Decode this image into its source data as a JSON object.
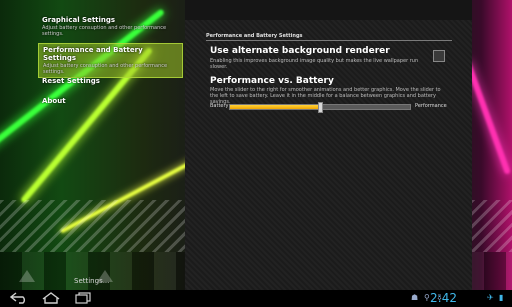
{
  "sidebar": {
    "items": [
      {
        "title": "Graphical Settings",
        "subtitle": "Adjust battery consuption and other performance settings."
      },
      {
        "title": "Performance and Battery Settings",
        "subtitle": "Adjust battery consuption and other performance settings."
      },
      {
        "title": "Reset Settings",
        "subtitle": ""
      },
      {
        "title": "About",
        "subtitle": ""
      }
    ],
    "active_index": 1,
    "footer": "Settings..."
  },
  "panel": {
    "header": "Performance and Battery Settings",
    "alternate_background": {
      "title": "Use alternate background renderer",
      "summary": "Enabling this improves background image quality but makes the live wallpaper run slower.",
      "checked": false
    },
    "performance": {
      "title": "Performance vs. Battery",
      "summary": "Move the slider to the right for smoother animations and better graphics. Move the slider to the left to save battery. Leave it in the middle for a balance between graphics and battery savings.",
      "left_label": "Battery",
      "right_label": "Performance",
      "value": 0.5
    }
  },
  "system_bar": {
    "back_icon": "back-icon",
    "home_icon": "home-icon",
    "recents_icon": "recents-icon",
    "time": "2:42",
    "accent_color": "#3fb6e8"
  }
}
